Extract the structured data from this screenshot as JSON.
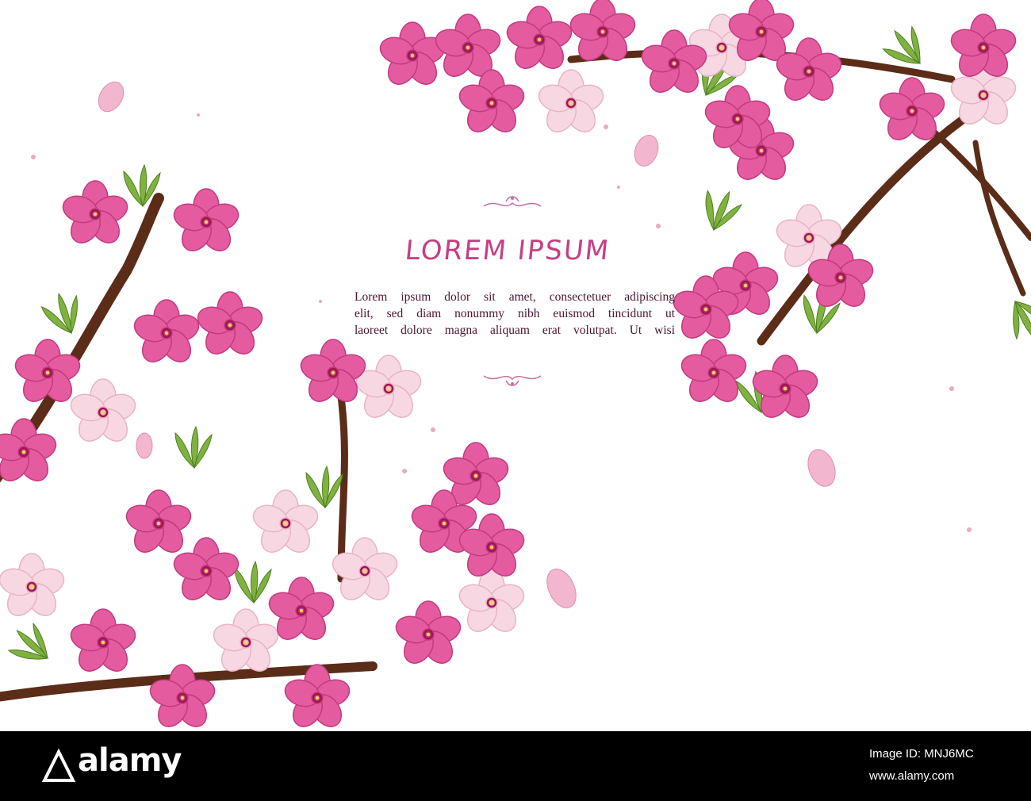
{
  "card": {
    "headline": "LOREM IPSUM",
    "body_lines": [
      "Lorem ipsum dolor sit amet, consectetuer adipiscing",
      "elit, sed diam nonummy nibh euismod tincidunt ut",
      "laoreet dolore magna aliquam erat volutpat. Ut wisi"
    ]
  },
  "footer": {
    "brand": "alamy",
    "image_id_label": "Image ID: MNJ6MC",
    "site": "www.alamy.com"
  },
  "colors": {
    "blossom": "#e45c9f",
    "blossom_light": "#f3a9cc",
    "blossom_pale": "#f7d8e2",
    "branch": "#5b2c18",
    "leaf": "#7fb23f",
    "headline": "#c53f83"
  }
}
